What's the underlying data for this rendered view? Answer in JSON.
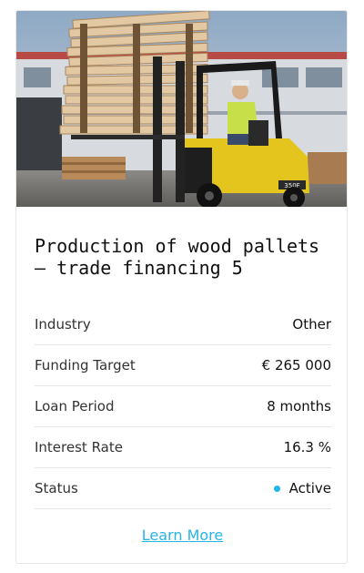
{
  "project": {
    "title": "Production of wood pallets – trade financing 5",
    "image_subject": "forklift carrying stacked wood pallets",
    "forklift_badge": "350F"
  },
  "details": [
    {
      "label": "Industry",
      "value": "Other"
    },
    {
      "label": "Funding Target",
      "value": "€ 265 000"
    },
    {
      "label": "Loan Period",
      "value": "8 months"
    },
    {
      "label": "Interest Rate",
      "value": "16.3 %"
    },
    {
      "label": "Status",
      "value": "Active"
    }
  ],
  "status_color": "#1fb6ea",
  "link_color": "#27b4e6",
  "actions": {
    "learn_more": "Learn More"
  }
}
